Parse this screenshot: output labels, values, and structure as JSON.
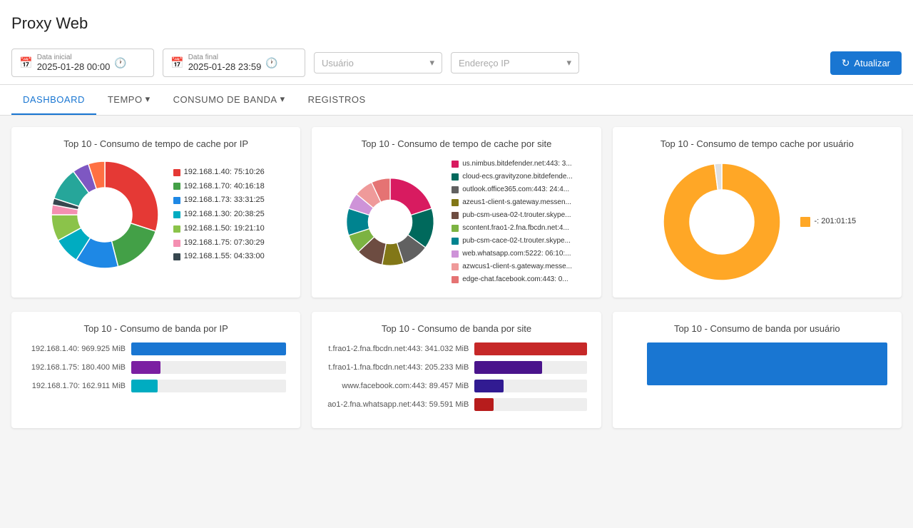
{
  "app": {
    "title": "Proxy Web"
  },
  "filters": {
    "date_start_label": "Data inicial",
    "date_start_value": "2025-01-28 00:00",
    "date_end_label": "Data final",
    "date_end_value": "2025-01-28 23:59",
    "user_placeholder": "Usuário",
    "ip_placeholder": "Endereço IP",
    "refresh_button": "Atualizar"
  },
  "nav": {
    "tabs": [
      {
        "id": "dashboard",
        "label": "DASHBOARD",
        "active": true,
        "has_arrow": false
      },
      {
        "id": "tempo",
        "label": "TEMPO",
        "active": false,
        "has_arrow": true
      },
      {
        "id": "consumo",
        "label": "CONSUMO DE BANDA",
        "active": false,
        "has_arrow": true
      },
      {
        "id": "registros",
        "label": "REGISTROS",
        "active": false,
        "has_arrow": false
      }
    ]
  },
  "charts": {
    "row1": [
      {
        "title": "Top 10 - Consumo de tempo de cache por IP",
        "type": "donut",
        "id": "donut-ip",
        "legend": [
          {
            "color": "#e53935",
            "label": "192.168.1.40: 75:10:26"
          },
          {
            "color": "#43a047",
            "label": "192.168.1.70: 40:16:18"
          },
          {
            "color": "#1e88e5",
            "label": "192.168.1.73: 33:31:25"
          },
          {
            "color": "#00acc1",
            "label": "192.168.1.30: 20:38:25"
          },
          {
            "color": "#8bc34a",
            "label": "192.168.1.50: 19:21:10"
          },
          {
            "color": "#f48fb1",
            "label": "192.168.1.75: 07:30:29"
          },
          {
            "color": "#37474f",
            "label": "192.168.1.55: 04:33:00"
          }
        ],
        "segments": [
          {
            "color": "#e53935",
            "pct": 30
          },
          {
            "color": "#43a047",
            "pct": 16
          },
          {
            "color": "#1e88e5",
            "pct": 13
          },
          {
            "color": "#00acc1",
            "pct": 8
          },
          {
            "color": "#8bc34a",
            "pct": 8
          },
          {
            "color": "#f48fb1",
            "pct": 3
          },
          {
            "color": "#37474f",
            "pct": 2
          },
          {
            "color": "#26a69a",
            "pct": 10
          },
          {
            "color": "#7e57c2",
            "pct": 5
          },
          {
            "color": "#ff7043",
            "pct": 5
          }
        ]
      },
      {
        "title": "Top 10 - Consumo de tempo de cache por site",
        "type": "donut",
        "id": "donut-site",
        "legend": [
          {
            "color": "#d81b60",
            "label": "us.nimbus.bitdefender.net:443: 3..."
          },
          {
            "color": "#00695c",
            "label": "cloud-ecs.gravityzone.bitdefende..."
          },
          {
            "color": "#616161",
            "label": "outlook.office365.com:443: 24:4..."
          },
          {
            "color": "#827717",
            "label": "azeus1-client-s.gateway.messen..."
          },
          {
            "color": "#6d4c41",
            "label": "pub-csm-usea-02-t.trouter.skype..."
          },
          {
            "color": "#7cb342",
            "label": "scontent.frao1-2.fna.fbcdn.net:4..."
          },
          {
            "color": "#00838f",
            "label": "pub-csm-cace-02-t.trouter.skype..."
          },
          {
            "color": "#ce93d8",
            "label": "web.whatsapp.com:5222: 06:10:..."
          },
          {
            "color": "#ef9a9a",
            "label": "azwcus1-client-s.gateway.messe..."
          },
          {
            "color": "#e57373",
            "label": "edge-chat.facebook.com:443: 0..."
          }
        ],
        "segments": [
          {
            "color": "#d81b60",
            "pct": 20
          },
          {
            "color": "#00695c",
            "pct": 15
          },
          {
            "color": "#616161",
            "pct": 10
          },
          {
            "color": "#827717",
            "pct": 8
          },
          {
            "color": "#6d4c41",
            "pct": 10
          },
          {
            "color": "#7cb342",
            "pct": 7
          },
          {
            "color": "#00838f",
            "pct": 10
          },
          {
            "color": "#ce93d8",
            "pct": 6
          },
          {
            "color": "#ef9a9a",
            "pct": 7
          },
          {
            "color": "#e57373",
            "pct": 7
          }
        ]
      },
      {
        "title": "Top 10 - Consumo de tempo cache por usuário",
        "type": "donut",
        "id": "donut-user",
        "legend": [
          {
            "color": "#ffa726",
            "label": "-: 201:01:15"
          }
        ],
        "segments": [
          {
            "color": "#ffa726",
            "pct": 98
          },
          {
            "color": "#e0e0e0",
            "pct": 2
          }
        ]
      }
    ],
    "row2": [
      {
        "title": "Top 10 - Consumo de banda por IP",
        "type": "bar",
        "id": "bar-ip",
        "bars": [
          {
            "label": "192.168.1.40: 969.925 MiB",
            "value": 100,
            "color": "#1976d2"
          },
          {
            "label": "192.168.1.75: 180.400 MiB",
            "value": 19,
            "color": "#7b1fa2"
          },
          {
            "label": "192.168.1.70: 162.911 MiB",
            "value": 17,
            "color": "#00acc1"
          }
        ]
      },
      {
        "title": "Top 10 - Consumo de banda por site",
        "type": "bar",
        "id": "bar-site",
        "bars": [
          {
            "label": "t.frao1-2.fna.fbcdn.net:443: 341.032 MiB",
            "value": 100,
            "color": "#c62828"
          },
          {
            "label": "t.frao1-1.fna.fbcdn.net:443: 205.233 MiB",
            "value": 60,
            "color": "#4a148c"
          },
          {
            "label": "www.facebook.com:443: 89.457 MiB",
            "value": 26,
            "color": "#311b92"
          },
          {
            "label": "ao1-2.fna.whatsapp.net:443: 59.591 MiB",
            "value": 17,
            "color": "#b71c1c"
          }
        ]
      },
      {
        "title": "Top 10 - Consumo de banda por usuário",
        "type": "bar",
        "id": "bar-user",
        "bars": [
          {
            "label": "",
            "value": 100,
            "color": "#1976d2"
          }
        ]
      }
    ]
  }
}
